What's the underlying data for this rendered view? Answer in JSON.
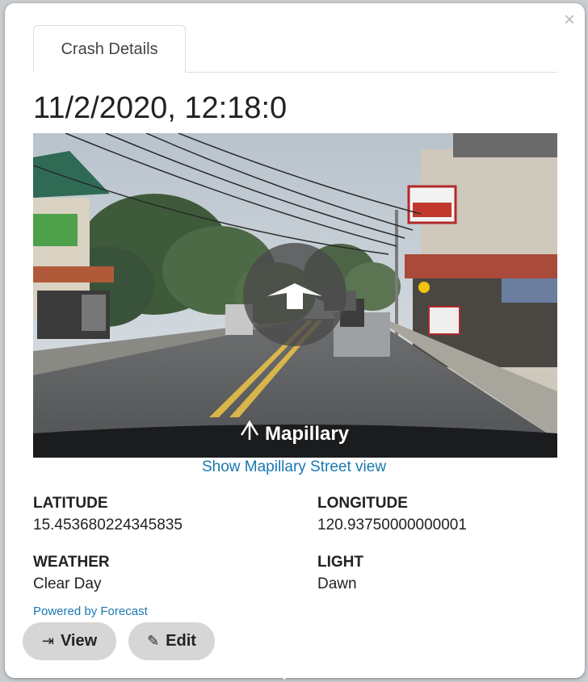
{
  "popup": {
    "close_label": "×",
    "tab_label": "Crash Details",
    "title": "11/2/2020, 12:18:0",
    "photo_watermark": "Mapillary",
    "street_view_link": "Show Mapillary Street view",
    "fields": {
      "latitude_label": "LATITUDE",
      "latitude_value": "15.453680224345835",
      "longitude_label": "LONGITUDE",
      "longitude_value": "120.93750000000001",
      "weather_label": "WEATHER",
      "weather_value": "Clear Day",
      "light_label": "LIGHT",
      "light_value": "Dawn"
    },
    "powered_by": "Powered by Forecast",
    "buttons": {
      "view_label": "View",
      "view_icon": "sign-in-icon",
      "edit_label": "Edit",
      "edit_icon": "pencil-icon"
    },
    "colors": {
      "link": "#1a78b0",
      "button_bg": "#d6d6d6"
    }
  }
}
